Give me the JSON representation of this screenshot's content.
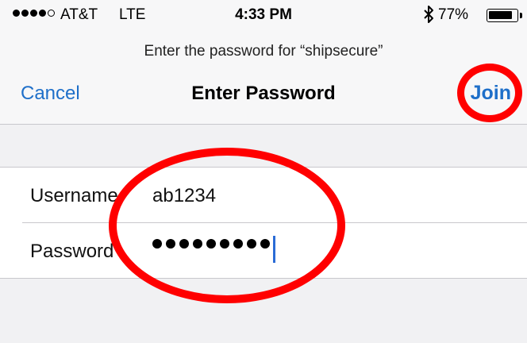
{
  "status_bar": {
    "carrier": "AT&T",
    "network": "LTE",
    "time": "4:33 PM",
    "battery_percent": "77%",
    "signal_icon": "signal-dots-icon",
    "bluetooth_icon": "bluetooth-icon",
    "battery_icon": "battery-icon"
  },
  "prompt": {
    "text": "Enter the password for “shipsecure”"
  },
  "nav": {
    "cancel_label": "Cancel",
    "title": "Enter Password",
    "join_label": "Join"
  },
  "form": {
    "username_label": "Username",
    "username_value": "ab1234",
    "password_label": "Password",
    "password_masked": "•••••••••"
  },
  "colors": {
    "accent": "#1e6fc9",
    "annotation": "#ff0000",
    "caret": "#2a6bd6"
  }
}
